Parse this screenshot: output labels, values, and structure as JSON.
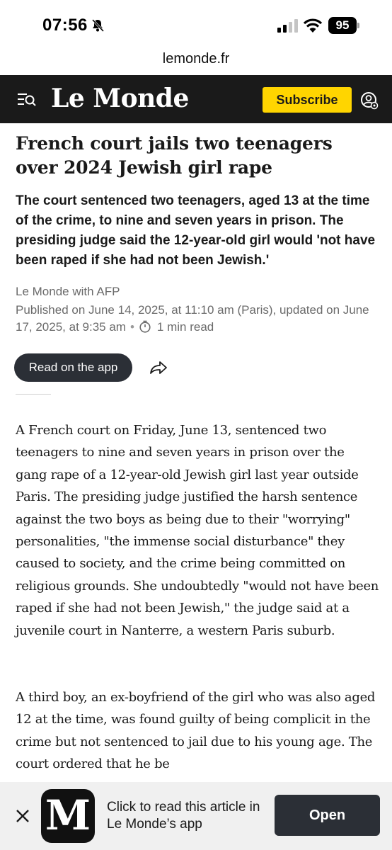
{
  "status_bar": {
    "time": "07:56",
    "battery": "95",
    "icons": [
      "bell-slash-icon",
      "signal-icon",
      "wifi-icon",
      "battery-icon"
    ]
  },
  "browser": {
    "url": "lemonde.fr"
  },
  "header": {
    "logo": "Le Monde",
    "subscribe_label": "Subscribe",
    "icons": [
      "menu-search-icon",
      "account-icon"
    ],
    "colors": {
      "bar": "#1a1a1a",
      "subscribe": "#ffd500"
    }
  },
  "article": {
    "headline": "French court jails two teenagers over 2024 Jewish girl rape",
    "standfirst": "The court sentenced two teenagers, aged 13 at the time of the crime, to nine and seven years in prison. The presiding judge said the 12-year-old girl would 'not have been raped if she had not been Jewish.'",
    "byline": "Le Monde with AFP",
    "published": "Published on June 14, 2025, at 11:10 am (Paris), updated on June 17, 2025, at 9:35 am",
    "read_time": "1 min read",
    "read_on_app_label": "Read on the app",
    "paragraphs": [
      "A French court on Friday, June 13, sentenced two teenagers to nine and seven years in prison over the gang rape of a 12-year-old Jewish girl last year outside Paris. The presiding judge justified the harsh sentence against the two boys as being due to their \"worrying\" personalities, \"the immense social disturbance\" they caused to society, and the crime being committed on religious grounds. She undoubtedly \"would not have been raped if she had not been Jewish,\" the judge said at a juvenile court in Nanterre, a western Paris suburb.",
      "A third boy, an ex-boyfriend of the girl who was also aged 12 at the time, was found guilty of being complicit in the crime but not sentenced to jail due to his young age. The court ordered that he be"
    ]
  },
  "app_banner": {
    "icon_letter": "M",
    "text": "Click to read this article in Le Monde’s app",
    "open_label": "Open"
  }
}
